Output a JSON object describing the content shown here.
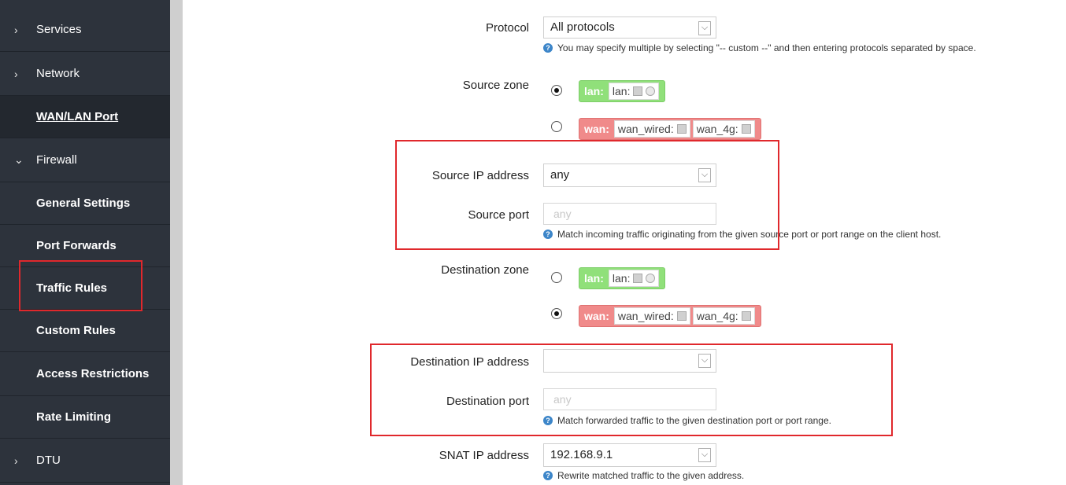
{
  "sidebar": {
    "items": [
      {
        "label": "Services"
      },
      {
        "label": "Network"
      },
      {
        "label": "WAN/LAN Port"
      },
      {
        "label": "Firewall"
      },
      {
        "label": "General Settings"
      },
      {
        "label": "Port Forwards"
      },
      {
        "label": "Traffic Rules"
      },
      {
        "label": "Custom Rules"
      },
      {
        "label": "Access Restrictions"
      },
      {
        "label": "Rate Limiting"
      },
      {
        "label": "DTU"
      }
    ]
  },
  "form": {
    "protocol": {
      "label": "Protocol",
      "value": "All protocols",
      "hint": "You may specify multiple by selecting \"-- custom --\" and then entering protocols separated by space."
    },
    "source_zone": {
      "label": "Source zone"
    },
    "source_ip": {
      "label": "Source IP address",
      "value": "any"
    },
    "source_port": {
      "label": "Source port",
      "placeholder": "any",
      "hint": "Match incoming traffic originating from the given source port or port range on the client host."
    },
    "dest_zone": {
      "label": "Destination zone"
    },
    "dest_ip": {
      "label": "Destination IP address",
      "value": ""
    },
    "dest_port": {
      "label": "Destination port",
      "placeholder": "any",
      "hint": "Match forwarded traffic to the given destination port or port range."
    },
    "snat_ip": {
      "label": "SNAT IP address",
      "value": "192.168.9.1",
      "hint": "Rewrite matched traffic to the given address."
    }
  },
  "zones": {
    "lan": {
      "name": "lan:",
      "net": "lan:"
    },
    "wan": {
      "name": "wan:",
      "net1": "wan_wired:",
      "net2": "wan_4g:"
    }
  },
  "colors": {
    "sidebar_bg": "#2d333c",
    "lan_zone": "#90e07a",
    "wan_zone": "#f08a8a",
    "highlight_box": "#e0282c",
    "help_icon": "#3d86c9"
  }
}
